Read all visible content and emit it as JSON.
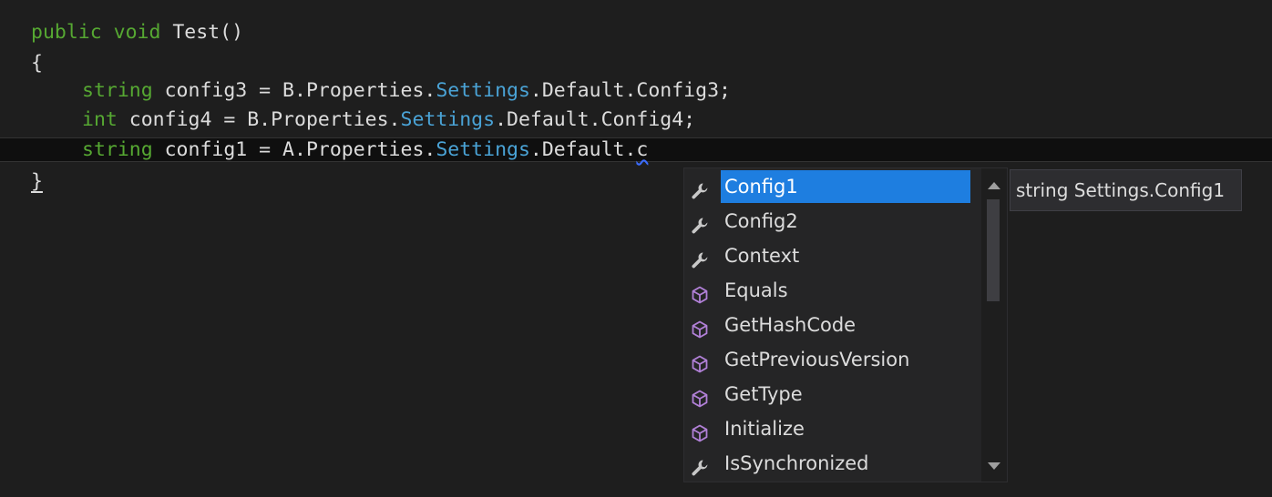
{
  "code": {
    "line1": {
      "kw1": "public",
      "kw2": "void",
      "rest": " Test()"
    },
    "line2": {
      "text": "{"
    },
    "line3": {
      "kw": "string",
      "pre": " config3 = B.Properties.",
      "type": "Settings",
      "post": ".Default.Config3;"
    },
    "line4": {
      "kw": "int",
      "pre": " config4 = B.Properties.",
      "type": "Settings",
      "post": ".Default.Config4;"
    },
    "line5": {
      "kw": "string",
      "pre": " config1 = A.Properties.",
      "type": "Settings",
      "post": ".Default.",
      "typed": "c"
    },
    "line6": {
      "text": "}"
    }
  },
  "completion": {
    "items": [
      {
        "label": "Config1",
        "icon": "wrench-icon",
        "selected": true
      },
      {
        "label": "Config2",
        "icon": "wrench-icon"
      },
      {
        "label": "Context",
        "icon": "wrench-icon"
      },
      {
        "label": "Equals",
        "icon": "method-cube-icon"
      },
      {
        "label": "GetHashCode",
        "icon": "method-cube-icon"
      },
      {
        "label": "GetPreviousVersion",
        "icon": "method-cube-icon"
      },
      {
        "label": "GetType",
        "icon": "method-cube-icon"
      },
      {
        "label": "Initialize",
        "icon": "method-cube-icon"
      },
      {
        "label": "IsSynchronized",
        "icon": "wrench-icon"
      }
    ],
    "selection_color": "#1e7ee0"
  },
  "tooltip": {
    "text": "string Settings.Config1"
  },
  "colors": {
    "keyword": "#56a832",
    "type": "#4aa3d6",
    "text": "#dcdcdc",
    "background": "#1e1e1e",
    "method_icon": "#b180d7"
  }
}
